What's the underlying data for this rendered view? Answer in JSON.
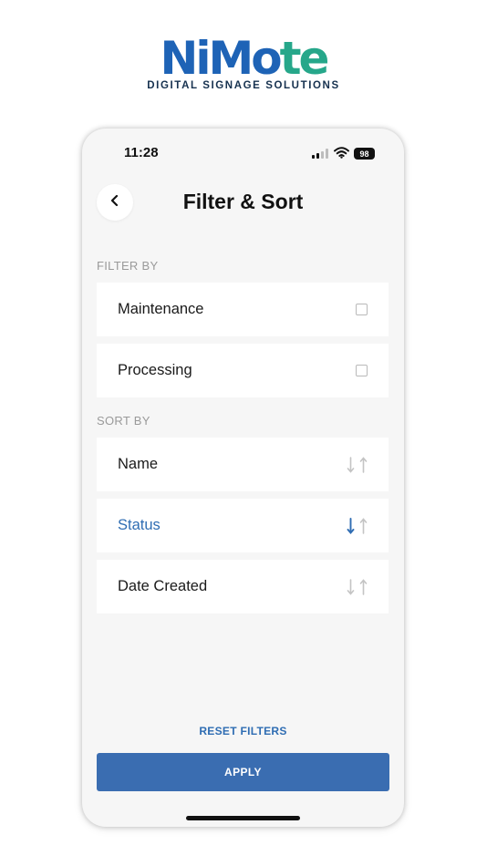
{
  "brand": {
    "name_part1": "Ni",
    "name_part2": "Mo",
    "name_part3": "te",
    "tagline": "DIGITAL SIGNAGE SOLUTIONS",
    "colors": {
      "blue": "#1e63b6",
      "green": "#26a78a"
    }
  },
  "status_bar": {
    "time": "11:28",
    "battery": "98",
    "icons": [
      "cellular-signal-icon",
      "wifi-icon",
      "battery-icon"
    ]
  },
  "header": {
    "title": "Filter & Sort",
    "back_icon": "chevron-left-icon"
  },
  "filter": {
    "label": "FILTER BY",
    "options": [
      {
        "label": "Maintenance",
        "checked": false
      },
      {
        "label": "Processing",
        "checked": false
      }
    ]
  },
  "sort": {
    "label": "SORT BY",
    "options": [
      {
        "label": "Name",
        "active": false,
        "direction": "none"
      },
      {
        "label": "Status",
        "active": true,
        "direction": "descending"
      },
      {
        "label": "Date Created",
        "active": false,
        "direction": "none"
      }
    ]
  },
  "actions": {
    "reset_label": "RESET FILTERS",
    "apply_label": "APPLY"
  },
  "colors": {
    "accent": "#2f6db3",
    "button_bg": "#3a6db1",
    "screen_bg": "#f6f6f6"
  }
}
